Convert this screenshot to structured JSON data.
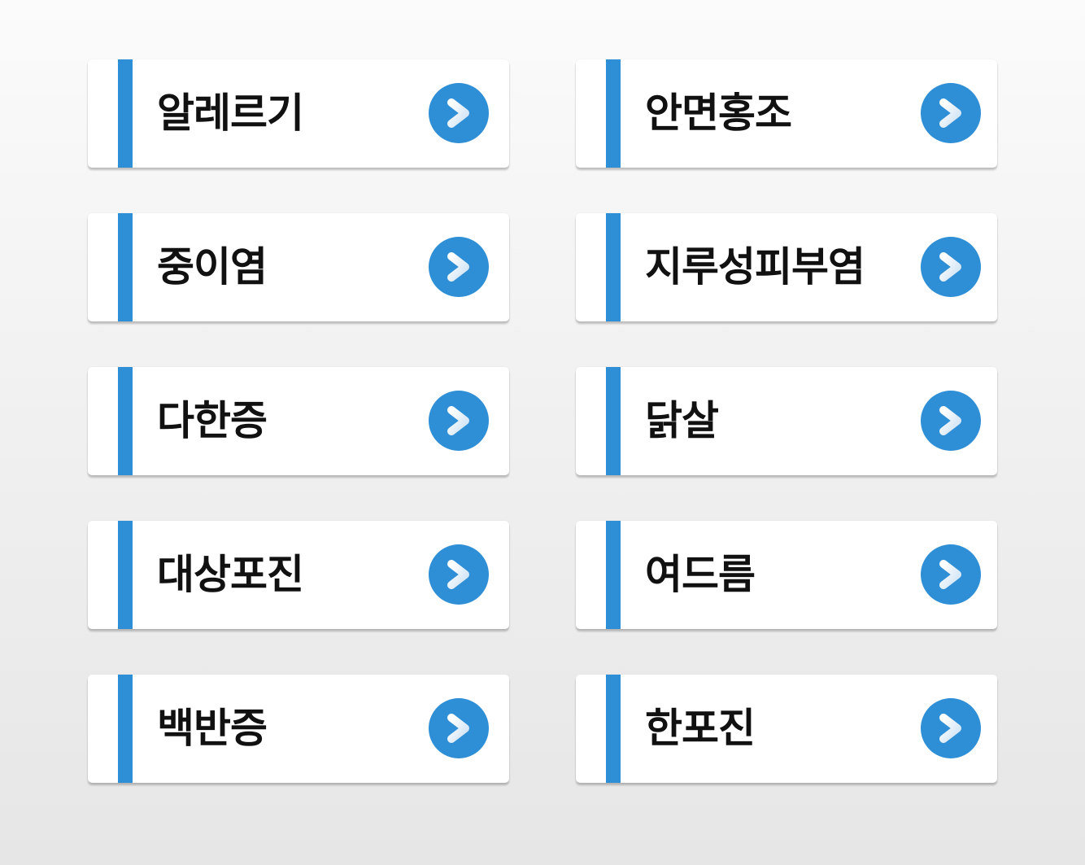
{
  "accent_color": "#2f8fd6",
  "arrow_icon": "chevron-right-circle-icon",
  "items": [
    {
      "label": "알레르기"
    },
    {
      "label": "안면홍조"
    },
    {
      "label": "중이염"
    },
    {
      "label": "지루성피부염"
    },
    {
      "label": "다한증"
    },
    {
      "label": "닭살"
    },
    {
      "label": "대상포진"
    },
    {
      "label": "여드름"
    },
    {
      "label": "백반증"
    },
    {
      "label": "한포진"
    }
  ]
}
